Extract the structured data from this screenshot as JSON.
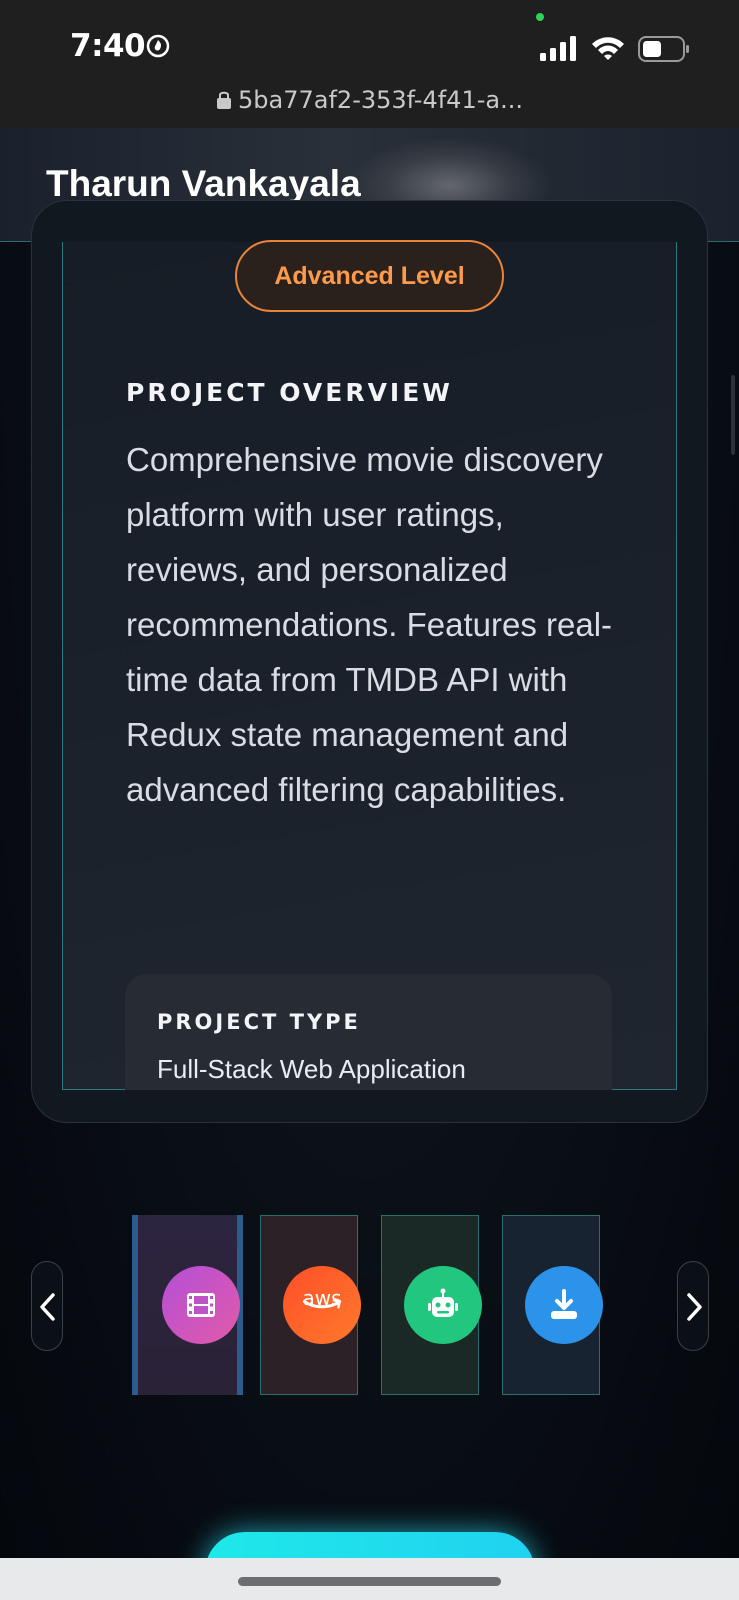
{
  "status_bar": {
    "time": "7:40",
    "url": "5ba77af2-353f-4f41-a..."
  },
  "header": {
    "title": "Tharun Vankayala"
  },
  "project": {
    "level_badge": "Advanced Level",
    "overview_heading": "PROJECT OVERVIEW",
    "overview_text": "Comprehensive movie discovery platform with user ratings, reviews, and personalized recommendations. Features real-time data from TMDB API with Redux state management and advanced filtering capabilities.",
    "type_heading": "PROJECT TYPE",
    "type_value": "Full-Stack Web Application"
  },
  "carousel": {
    "thumbnails": [
      {
        "icon": "film-icon",
        "color": "#c052c8"
      },
      {
        "icon": "aws-icon",
        "label": "aws",
        "color": "#ff5a2a"
      },
      {
        "icon": "robot-icon",
        "color": "#22c77f"
      },
      {
        "icon": "download-icon",
        "color": "#2b93ea"
      }
    ]
  },
  "colors": {
    "accent_orange": "#ff9a4a",
    "accent_teal": "#2c7a80",
    "cta_cyan": "#1fe8e9"
  }
}
